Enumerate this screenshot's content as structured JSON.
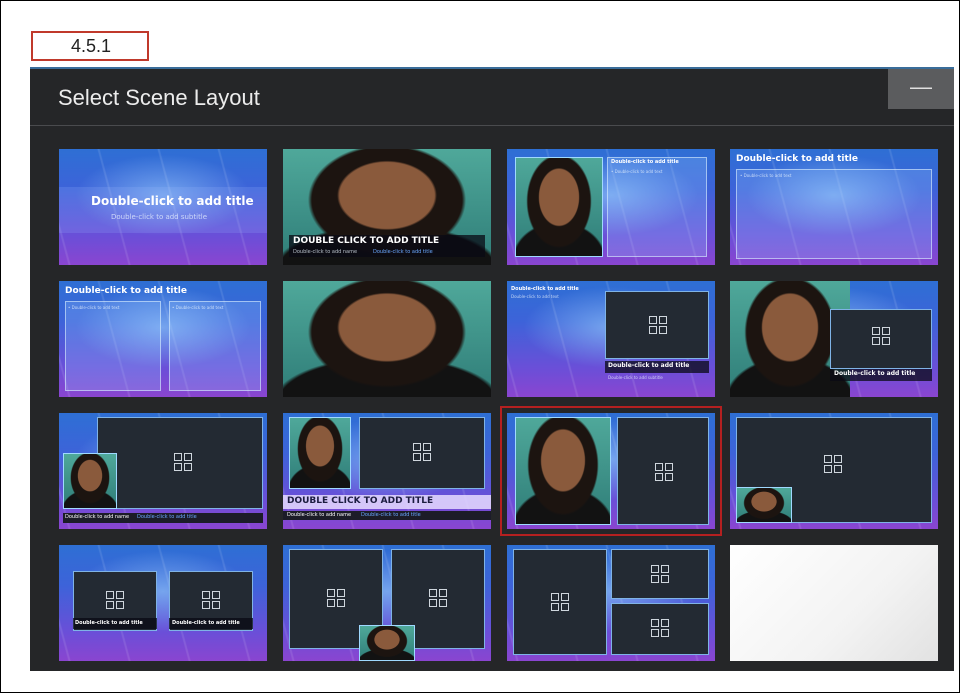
{
  "step": {
    "label": "4.5.1"
  },
  "dialog": {
    "title": "Select Scene Layout",
    "minimize_glyph": "—"
  },
  "thumbnails": {
    "t1": {
      "title": "Double-click to add title",
      "subtitle": "Double-click to add subtitle"
    },
    "t2": {
      "title": "DOUBLE CLICK TO ADD TITLE",
      "name": "Double-click to add name",
      "name_title": "Double-click to add title"
    },
    "t3": {
      "title": "Double-click to add title",
      "bullet": "• Double-click to add text"
    },
    "t4": {
      "title": "Double-click to add title",
      "bullet": "• Double-click to add text"
    },
    "t5": {
      "title": "Double-click to add title",
      "bullet_left": "• Double-click to add text",
      "bullet_right": "• Double-click to add text"
    },
    "t7": {
      "title_top": "Double-click to add title",
      "text_top": "Double-click to add text",
      "title": "Double-click to add title",
      "subtitle": "Double-click to add subtitle"
    },
    "t8": {
      "title": "Double-click to add title"
    },
    "t9": {
      "name": "Double-click to add name",
      "name_title": "Double-click to add title"
    },
    "t10": {
      "title": "DOUBLE CLICK TO ADD TITLE",
      "name": "Double-click to add name",
      "name_title": "Double-click to add title"
    },
    "t13": {
      "title_left": "Double-click to add title",
      "title_right": "Double-click to add title"
    }
  },
  "selected_thumbnail": "t11"
}
